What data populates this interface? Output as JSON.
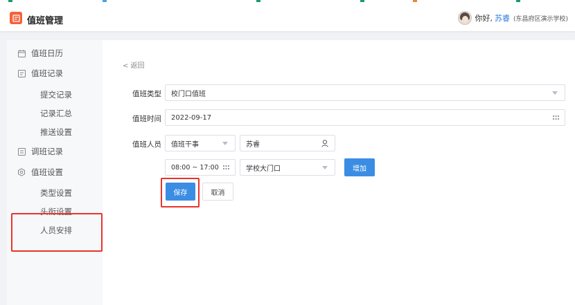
{
  "header": {
    "app_title": "值班管理",
    "greeting": "你好,",
    "user_name": "苏睿",
    "school": "(东昌府区演示学校)"
  },
  "sidebar": {
    "items": [
      {
        "label": "值班日历",
        "icon": "calendar-icon"
      },
      {
        "label": "值班记录",
        "icon": "record-icon"
      },
      {
        "label": "提交记录"
      },
      {
        "label": "记录汇总"
      },
      {
        "label": "推送设置"
      },
      {
        "label": "调班记录",
        "icon": "swap-icon"
      },
      {
        "label": "值班设置",
        "icon": "settings-icon"
      },
      {
        "label": "类型设置"
      },
      {
        "label": "头衔设置"
      },
      {
        "label": "人员安排"
      }
    ]
  },
  "main": {
    "back_label": "< 返回",
    "form": {
      "type_label": "值班类型",
      "type_value": "校门口值班",
      "time_label": "值班时间",
      "date_value": "2022-09-17",
      "staff_label": "值班人员",
      "role_value": "值班干事",
      "person_value": "苏睿",
      "time_range_value": "08:00 ~ 17:00",
      "location_value": "学校大门口",
      "add_label": "增加"
    },
    "save_label": "保存",
    "cancel_label": "取消"
  },
  "colors": {
    "accent": "#3b8de3",
    "brand": "#f4623a",
    "highlight": "#e8332c",
    "link": "#2e7de1"
  }
}
